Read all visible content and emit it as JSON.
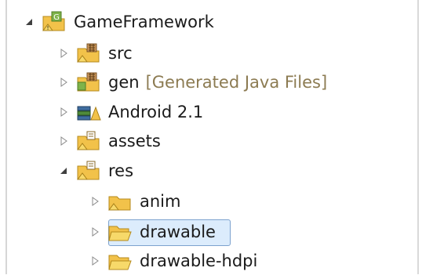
{
  "tree": {
    "root": {
      "label": "GameFramework",
      "expanded": true,
      "icon": "project-icon"
    },
    "items": [
      {
        "label": "src",
        "icon": "source-folder-icon",
        "expanded": false
      },
      {
        "label": "gen",
        "note": "[Generated Java Files]",
        "icon": "generated-source-folder-icon",
        "expanded": false
      },
      {
        "label": "Android 2.1",
        "icon": "library-icon",
        "expanded": false
      },
      {
        "label": "assets",
        "icon": "folder-icon",
        "expanded": false
      },
      {
        "label": "res",
        "icon": "folder-icon",
        "expanded": true,
        "children": [
          {
            "label": "anim",
            "icon": "folder-icon",
            "expanded": false
          },
          {
            "label": "drawable",
            "icon": "folder-open-icon",
            "expanded": false,
            "selected": true
          },
          {
            "label": "drawable-hdpi",
            "icon": "folder-open-icon",
            "expanded": false
          }
        ]
      }
    ]
  },
  "colors": {
    "selection_bg": "#dcecfc",
    "selection_border": "#7da2ce",
    "folder_yellow": "#f2c24a",
    "note_text": "#8c7b52"
  }
}
